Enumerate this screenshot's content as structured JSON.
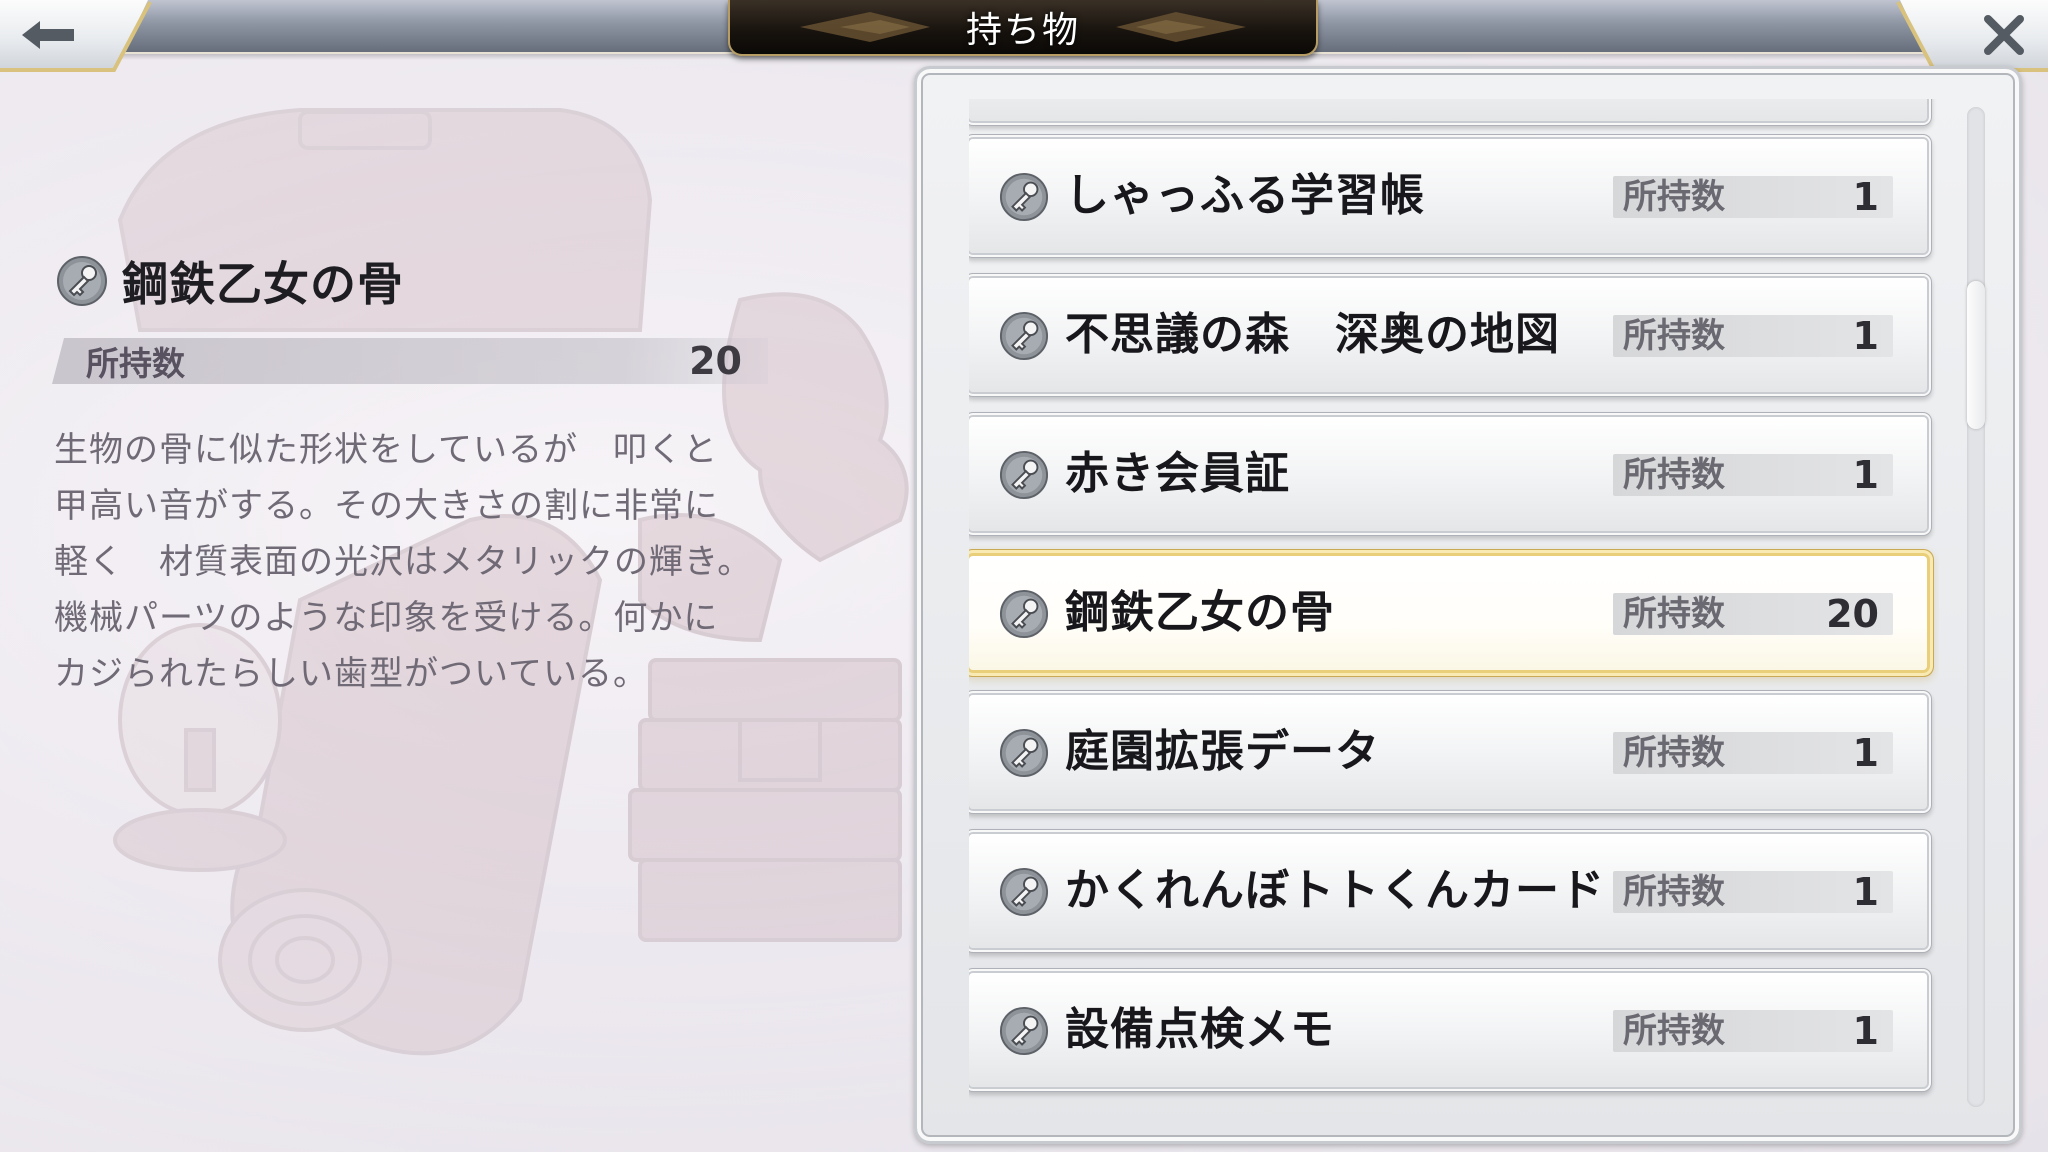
{
  "header": {
    "title": "持ち物",
    "back_icon": "arrow-left-icon",
    "close_icon": "close-x-icon"
  },
  "detail": {
    "item_name": "鋼鉄乙女の骨",
    "count_label": "所持数",
    "count_value": "20",
    "description_lines": [
      "生物の骨に似た形状をしているが　叩くと",
      "甲高い音がする。その大きさの割に非常に",
      "軽く　材質表面の光沢はメタリックの輝き。",
      "機械パーツのような印象を受ける。何かに",
      "カジられたらしい歯型がついている。"
    ],
    "icon": "key-item-icon"
  },
  "list": {
    "count_label": "所持数",
    "items": [
      {
        "name": "しゃっふる学習帳",
        "count": "1",
        "selected": false
      },
      {
        "name": "不思議の森　深奥の地図",
        "count": "1",
        "selected": false
      },
      {
        "name": "赤き会員証",
        "count": "1",
        "selected": false
      },
      {
        "name": "鋼鉄乙女の骨",
        "count": "20",
        "selected": true
      },
      {
        "name": "庭園拡張データ",
        "count": "1",
        "selected": false
      },
      {
        "name": "かくれんぼトトくんカード",
        "count": "1",
        "selected": false
      },
      {
        "name": "設備点検メモ",
        "count": "1",
        "selected": false
      }
    ]
  },
  "colors": {
    "selected_border": "#e9cf7a",
    "title_plate": "#17120d",
    "title_trim": "#b79d64"
  }
}
